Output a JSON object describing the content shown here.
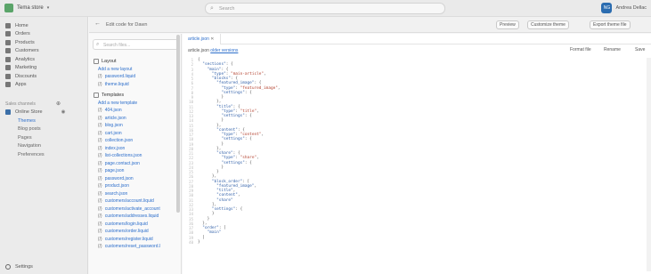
{
  "topbar": {
    "store_name": "Tema store",
    "search_placeholder": "Search",
    "avatar_initials": "NG",
    "user_name": "Andrea Dellac"
  },
  "nav": {
    "items": [
      {
        "label": "Home"
      },
      {
        "label": "Orders"
      },
      {
        "label": "Products"
      },
      {
        "label": "Customers"
      },
      {
        "label": "Analytics"
      },
      {
        "label": "Marketing"
      },
      {
        "label": "Discounts"
      },
      {
        "label": "Apps"
      }
    ],
    "section_label": "Sales channels",
    "channel": "Online Store",
    "sub_items": [
      {
        "label": "Themes",
        "active": true
      },
      {
        "label": "Blog posts",
        "active": false
      },
      {
        "label": "Pages",
        "active": false
      },
      {
        "label": "Navigation",
        "active": false
      },
      {
        "label": "Preferences",
        "active": false
      }
    ],
    "settings_label": "Settings"
  },
  "header": {
    "title": "Edit code for Dawn",
    "buttons": [
      "Preview",
      "Customize theme",
      "Export theme file"
    ]
  },
  "files": {
    "search_placeholder": "Search files...",
    "groups": [
      {
        "name": "Layout",
        "add_label": "Add a new layout",
        "items": [
          "password.liquid",
          "theme.liquid"
        ]
      },
      {
        "name": "Templates",
        "add_label": "Add a new template",
        "items": [
          "404.json",
          "article.json",
          "blog.json",
          "cart.json",
          "collection.json",
          "index.json",
          "list-collections.json",
          "page.contact.json",
          "page.json",
          "password.json",
          "product.json",
          "search.json",
          "customers/account.liquid",
          "customers/activate_account",
          "customers/addresses.liquid",
          "customers/login.liquid",
          "customers/order.liquid",
          "customers/register.liquid",
          "customers/reset_password.l"
        ]
      }
    ]
  },
  "editor": {
    "tab_label": "article.json",
    "path_prefix": "article.json",
    "path_link": "older versions",
    "buttons": [
      "Format file",
      "Rename",
      "Save"
    ],
    "line_numbers": [
      "1",
      "2",
      "3",
      "4",
      "5",
      "6",
      "7",
      "8",
      "9",
      "10",
      "11",
      "12",
      "13",
      "14",
      "15",
      "16",
      "17",
      "18",
      "19",
      "20",
      "21",
      "22",
      "23",
      "24",
      "25",
      "26",
      "27",
      "28",
      "29",
      "30",
      "31",
      "32",
      "33",
      "34",
      "35",
      "36",
      "37",
      "38",
      "39",
      "40"
    ],
    "code_lines": [
      "{",
      "  \"sections\": {",
      "    \"main\": {",
      "      \"type\": \"main-article\",",
      "      \"blocks\": {",
      "        \"featured_image\": {",
      "          \"type\": \"featured_image\",",
      "          \"settings\": {",
      "          }",
      "        },",
      "        \"title\": {",
      "          \"type\": \"title\",",
      "          \"settings\": {",
      "          }",
      "        },",
      "        \"content\": {",
      "          \"type\": \"content\",",
      "          \"settings\": {",
      "          }",
      "        },",
      "        \"share\": {",
      "          \"type\": \"share\",",
      "          \"settings\": {",
      "          }",
      "        }",
      "      },",
      "      \"block_order\": [",
      "        \"featured_image\",",
      "        \"title\",",
      "        \"content\",",
      "        \"share\"",
      "      ],",
      "      \"settings\": {",
      "      }",
      "    }",
      "  },",
      "  \"order\": [",
      "    \"main\"",
      "  ]",
      "}"
    ]
  }
}
